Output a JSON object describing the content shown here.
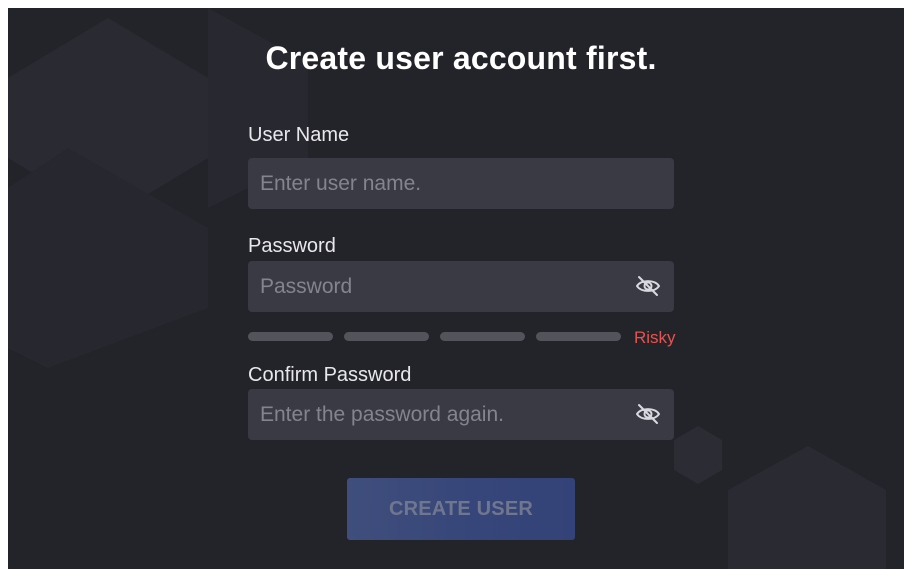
{
  "page": {
    "title": "Create user account first."
  },
  "form": {
    "username": {
      "label": "User Name",
      "placeholder": "Enter user name.",
      "value": ""
    },
    "password": {
      "label": "Password",
      "placeholder": "Password",
      "value": "",
      "visibility_icon": "eye-off-icon"
    },
    "strength": {
      "level_text": "Risky",
      "segments_total": 4,
      "segments_filled": 0,
      "level_color": "#e8524f"
    },
    "confirm_password": {
      "label": "Confirm Password",
      "placeholder": "Enter the password again.",
      "value": "",
      "visibility_icon": "eye-off-icon"
    },
    "submit": {
      "label": "CREATE USER",
      "enabled": false
    }
  },
  "colors": {
    "background": "#23232a",
    "field": "#3a3a45",
    "accent": "#3f5499"
  }
}
